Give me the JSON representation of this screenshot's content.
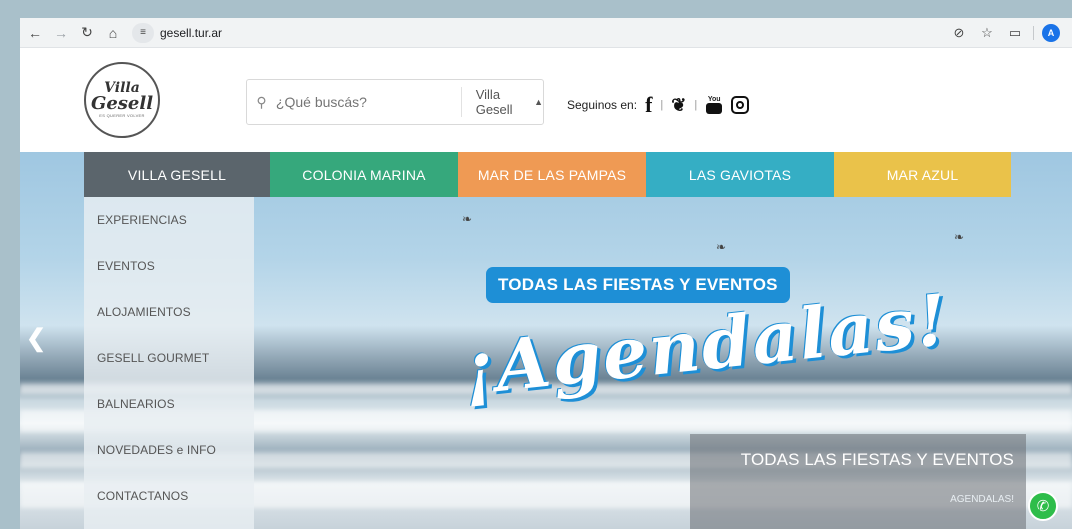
{
  "browser": {
    "url": "gesell.tur.ar",
    "profile_initial": "A",
    "icons": [
      "back-icon",
      "forward-icon",
      "reload-icon",
      "home-icon",
      "site-settings-icon",
      "eye-off-icon",
      "star-icon",
      "extensions-icon"
    ]
  },
  "header": {
    "logo": {
      "line1": "Villa",
      "line2": "Gesell",
      "line3": "ES QUERER VOLVER"
    },
    "search": {
      "placeholder": "¿Qué buscás?",
      "location": "Villa Gesell"
    },
    "social_label": "Seguinos en:",
    "social_icons": [
      "facebook-icon",
      "twitter-icon",
      "youtube-icon",
      "instagram-icon"
    ],
    "youtube_text": "You"
  },
  "nav": {
    "tabs": [
      {
        "label": "VILLA GESELL",
        "color": "#5b656c"
      },
      {
        "label": "COLONIA MARINA",
        "color": "#36a87c"
      },
      {
        "label": "MAR DE LAS PAMPAS",
        "color": "#ef9a54"
      },
      {
        "label": "LAS GAVIOTAS",
        "color": "#35aec4"
      },
      {
        "label": "MAR AZUL",
        "color": "#eac24a"
      }
    ],
    "menu": [
      "EXPERIENCIAS",
      "EVENTOS",
      "ALOJAMIENTOS",
      "GESELL GOURMET",
      "BALNEARIOS",
      "NOVEDADES e INFO",
      "CONTACTANOS"
    ]
  },
  "hero": {
    "banner": "TODAS LAS FIESTAS Y EVENTOS",
    "script": "¡Agendalas!",
    "caption_title": "TODAS LAS FIESTAS Y EVENTOS",
    "caption_link": "AGENDALAS!",
    "accent": "#1e8fd6"
  }
}
